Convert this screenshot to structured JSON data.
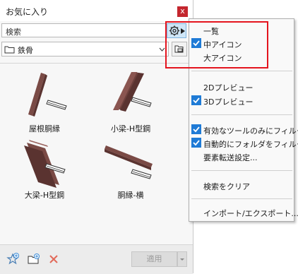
{
  "panel": {
    "title": "お気に入り",
    "close_label": "x"
  },
  "search": {
    "placeholder": "検索"
  },
  "folder": {
    "selected": "鉄骨"
  },
  "items": [
    {
      "label": "屋根胴縁"
    },
    {
      "label": "小梁-H型鋼"
    },
    {
      "label": "大梁-H型鋼"
    },
    {
      "label": "胴縁-横"
    }
  ],
  "bottom": {
    "apply_label": "適用"
  },
  "menu": {
    "view_items": [
      {
        "label": "一覧",
        "checked": false
      },
      {
        "label": "中アイコン",
        "checked": true
      },
      {
        "label": "大アイコン",
        "checked": false
      }
    ],
    "preview_items": [
      {
        "label": "2Dプレビュー",
        "checked": false
      },
      {
        "label": "3Dプレビュー",
        "checked": true
      }
    ],
    "filter_items": [
      {
        "label": "有効なツールのみにフィルタ",
        "checked": true
      },
      {
        "label": "自動的にフォルダをフィルタ",
        "checked": true
      },
      {
        "label": "要素転送設定...",
        "checked": false
      }
    ],
    "clear_search": "検索をクリア",
    "import_export": "インポート/エクスポート..."
  },
  "colors": {
    "accent": "#1f7bd6",
    "close": "#c4262e",
    "highlight": "#e4141e",
    "steel": "#7a4a45"
  }
}
